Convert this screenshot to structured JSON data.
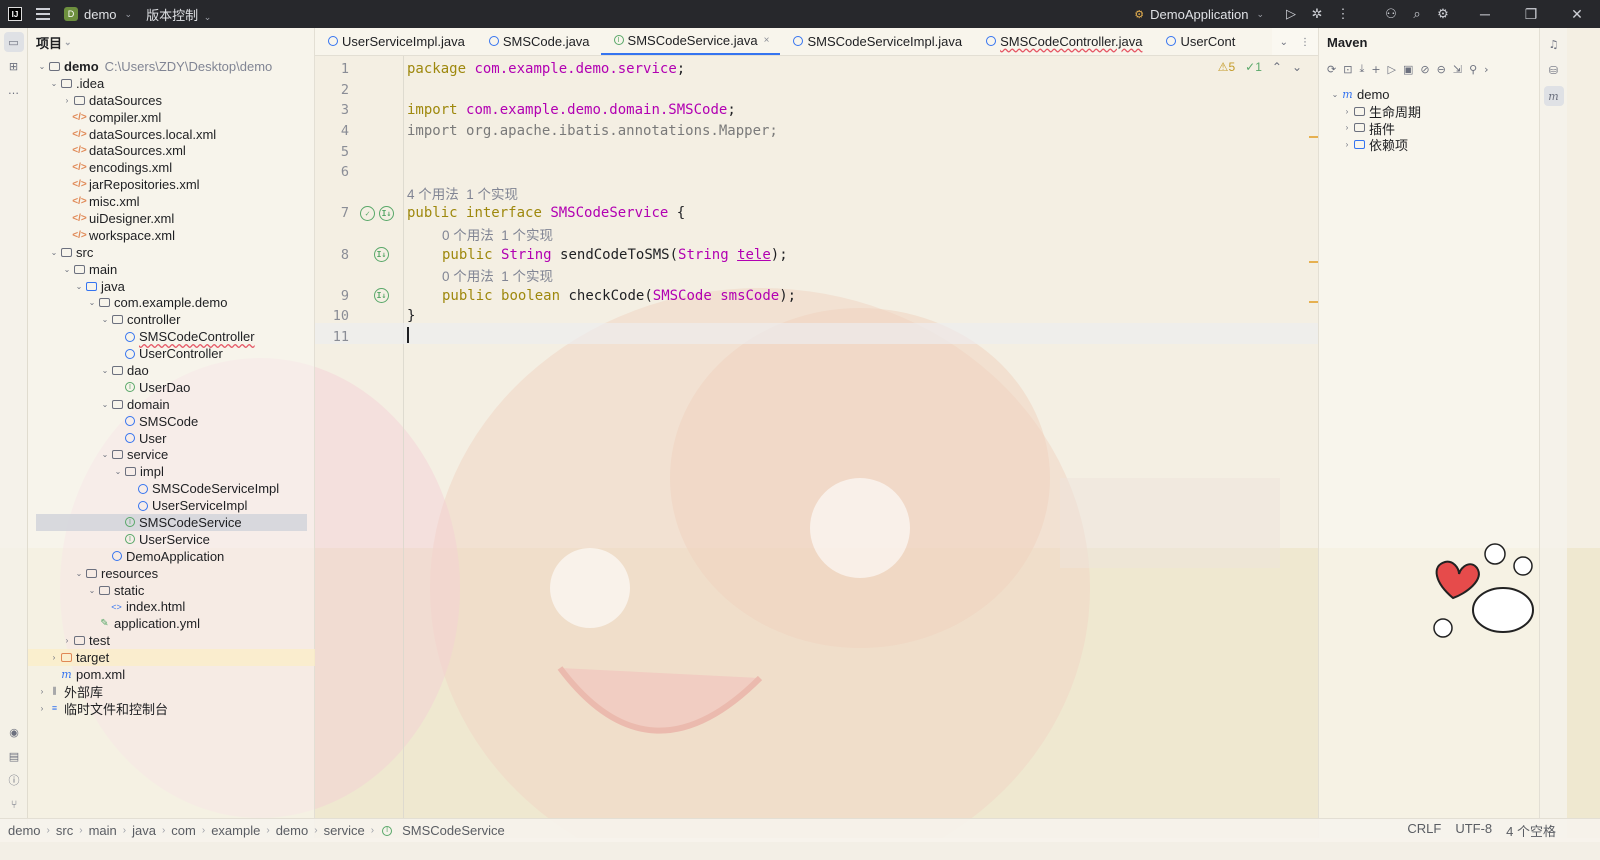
{
  "titlebar": {
    "project_badge": "D",
    "project_name": "demo",
    "vcs_label": "版本控制",
    "run_config": "DemoApplication"
  },
  "project_panel": {
    "title": "项目",
    "tree": [
      {
        "label": "demo",
        "path": "C:\\Users\\ZDY\\Desktop\\demo"
      },
      {
        "label": ".idea"
      },
      {
        "label": "dataSources"
      },
      {
        "label": "compiler.xml"
      },
      {
        "label": "dataSources.local.xml"
      },
      {
        "label": "dataSources.xml"
      },
      {
        "label": "encodings.xml"
      },
      {
        "label": "jarRepositories.xml"
      },
      {
        "label": "misc.xml"
      },
      {
        "label": "uiDesigner.xml"
      },
      {
        "label": "workspace.xml"
      },
      {
        "label": "src"
      },
      {
        "label": "main"
      },
      {
        "label": "java"
      },
      {
        "label": "com.example.demo"
      },
      {
        "label": "controller"
      },
      {
        "label": "SMSCodeController"
      },
      {
        "label": "UserController"
      },
      {
        "label": "dao"
      },
      {
        "label": "UserDao"
      },
      {
        "label": "domain"
      },
      {
        "label": "SMSCode"
      },
      {
        "label": "User"
      },
      {
        "label": "service"
      },
      {
        "label": "impl"
      },
      {
        "label": "SMSCodeServiceImpl"
      },
      {
        "label": "UserServiceImpl"
      },
      {
        "label": "SMSCodeService"
      },
      {
        "label": "UserService"
      },
      {
        "label": "DemoApplication"
      },
      {
        "label": "resources"
      },
      {
        "label": "static"
      },
      {
        "label": "index.html"
      },
      {
        "label": "application.yml"
      },
      {
        "label": "test"
      },
      {
        "label": "target"
      },
      {
        "label": "pom.xml"
      },
      {
        "label": "外部库"
      },
      {
        "label": "临时文件和控制台"
      }
    ]
  },
  "tabs": [
    {
      "label": "UserServiceImpl.java"
    },
    {
      "label": "SMSCode.java"
    },
    {
      "label": "SMSCodeService.java",
      "close": "×"
    },
    {
      "label": "SMSCodeServiceImpl.java"
    },
    {
      "label": "SMSCodeController.java"
    },
    {
      "label": "UserCont"
    }
  ],
  "editor": {
    "inspections": {
      "warnings": "5",
      "ok": "1"
    },
    "line_numbers": [
      "1",
      "2",
      "3",
      "4",
      "5",
      "6",
      "7",
      "8",
      "9",
      "10",
      "11"
    ],
    "lines": {
      "l1_kw": "package",
      "l1_pkg": "com.example.demo.service",
      "l1_end": ";",
      "l3_kw": "import",
      "l3_pkg": "com.example.demo.domain.SMSCode",
      "l3_end": ";",
      "l4": "import org.apache.ibatis.annotations.Mapper;",
      "hint_interface": "4 个用法  1 个实现",
      "l7_public": "public",
      "l7_interface": "interface",
      "l7_name": "SMSCodeService",
      "l7_brace": "{",
      "hint_m1": "0 个用法  1 个实现",
      "l8_public": "public",
      "l8_type": "String",
      "l8_name": "sendCodeToSMS(",
      "l8_ptype": "String",
      "l8_param": "tele",
      "l8_end": ");",
      "hint_m2": "0 个用法  1 个实现",
      "l9_public": "public",
      "l9_type": "boolean",
      "l9_name": "checkCode(",
      "l9_ptype": "SMSCode",
      "l9_param": "smsCode",
      "l9_end": ");",
      "l10": "}"
    }
  },
  "maven": {
    "title": "Maven",
    "root": "demo",
    "items": [
      "生命周期",
      "插件",
      "依赖项"
    ]
  },
  "statusbar": {
    "breadcrumbs": [
      "demo",
      "src",
      "main",
      "java",
      "com",
      "example",
      "demo",
      "service",
      "SMSCodeService"
    ],
    "line_sep": "CRLF",
    "encoding": "UTF-8",
    "indent": "4 个空格"
  },
  "colors": {
    "accent": "#3574f0",
    "keyword": "#9e880d",
    "type": "#b200b2",
    "titlebar": "#27282c"
  }
}
